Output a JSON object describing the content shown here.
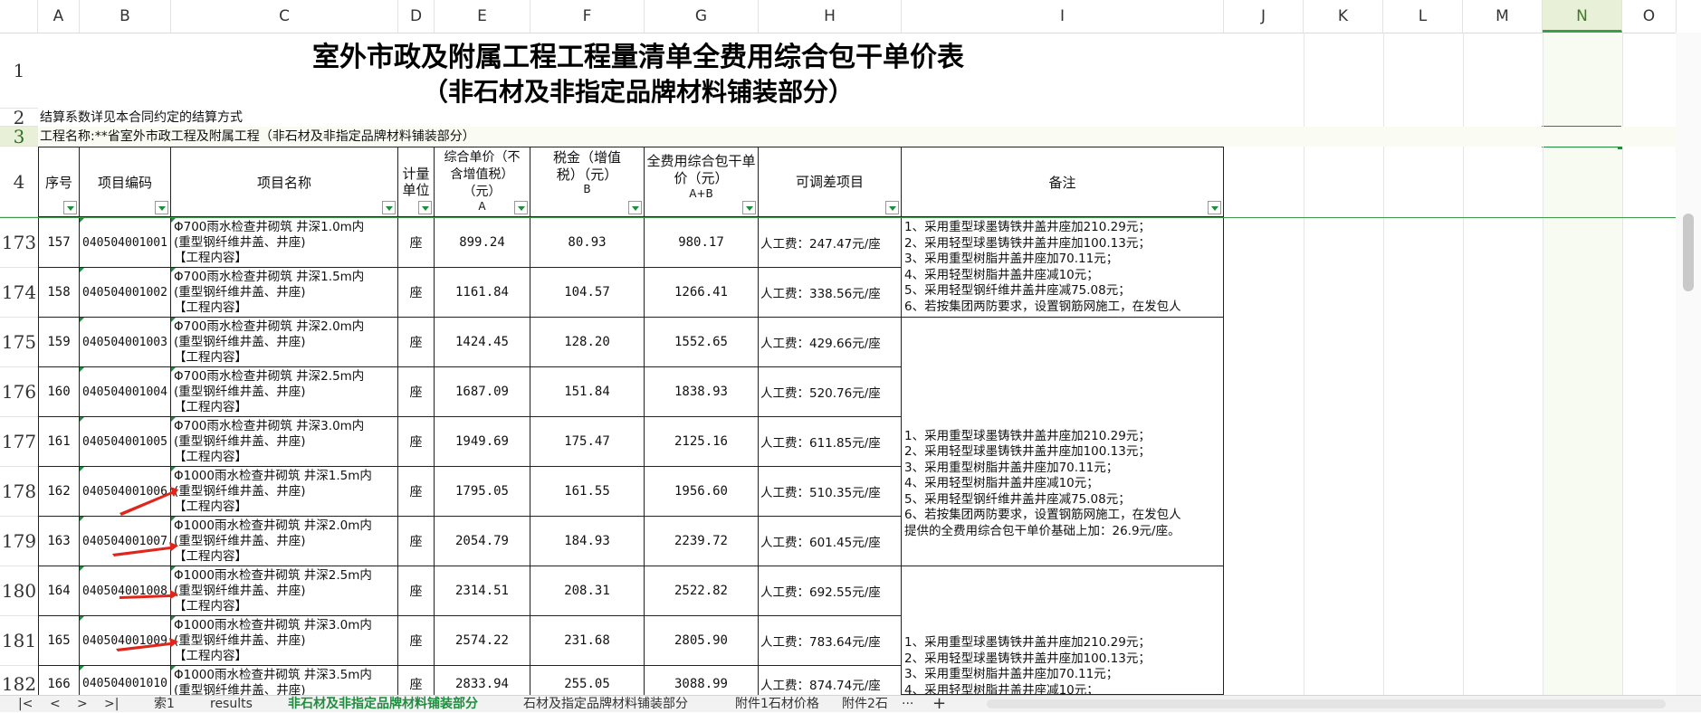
{
  "columns": [
    "A",
    "B",
    "C",
    "D",
    "E",
    "F",
    "G",
    "H",
    "I",
    "J",
    "K",
    "L",
    "M",
    "N",
    "O"
  ],
  "selected_column": "N",
  "rows_top": [
    "1",
    "2",
    "3",
    "4"
  ],
  "title_line1": "室外市政及附属工程工程量清单全费用综合包干单价表",
  "title_line2": "（非石材及非指定品牌材料铺装部分）",
  "row2_text": "结算系数详见本合同约定的结算方式",
  "row3_text": "工程名称:**省室外市政工程及附属工程（非石材及非指定品牌材料铺装部分）",
  "headers": {
    "seq": "序号",
    "code": "项目编码",
    "name": "项目名称",
    "unit": "计量单位",
    "price": "综合单价（不含增值税）（元）",
    "price_sub": "A",
    "tax": "税金（增值税）（元）",
    "tax_sub": "B",
    "total": "全费用综合包干单价（元）",
    "total_sub": "A+B",
    "adjust": "可调差项目",
    "remark": "备注"
  },
  "data_rows": [
    {
      "row": "173",
      "seq": "157",
      "code": "040504001001",
      "name": [
        "Φ700雨水检查井砌筑 井深1.0m内",
        "(重型钢纤维井盖、井座)",
        "【工程内容】"
      ],
      "unit": "座",
      "price": "899.24",
      "tax": "80.93",
      "total": "980.17",
      "adjust": "人工费：247.47元/座"
    },
    {
      "row": "174",
      "seq": "158",
      "code": "040504001002",
      "name": [
        "Φ700雨水检查井砌筑 井深1.5m内",
        "(重型钢纤维井盖、井座)",
        "【工程内容】"
      ],
      "unit": "座",
      "price": "1161.84",
      "tax": "104.57",
      "total": "1266.41",
      "adjust": "人工费：338.56元/座"
    },
    {
      "row": "175",
      "seq": "159",
      "code": "040504001003",
      "name": [
        "Φ700雨水检查井砌筑 井深2.0m内",
        "(重型钢纤维井盖、井座)",
        "【工程内容】"
      ],
      "unit": "座",
      "price": "1424.45",
      "tax": "128.20",
      "total": "1552.65",
      "adjust": "人工费：429.66元/座"
    },
    {
      "row": "176",
      "seq": "160",
      "code": "040504001004",
      "name": [
        "Φ700雨水检查井砌筑 井深2.5m内",
        "(重型钢纤维井盖、井座)",
        "【工程内容】"
      ],
      "unit": "座",
      "price": "1687.09",
      "tax": "151.84",
      "total": "1838.93",
      "adjust": "人工费：520.76元/座"
    },
    {
      "row": "177",
      "seq": "161",
      "code": "040504001005",
      "name": [
        "Φ700雨水检查井砌筑 井深3.0m内",
        "(重型钢纤维井盖、井座)",
        "【工程内容】"
      ],
      "unit": "座",
      "price": "1949.69",
      "tax": "175.47",
      "total": "2125.16",
      "adjust": "人工费：611.85元/座"
    },
    {
      "row": "178",
      "seq": "162",
      "code": "040504001006",
      "name": [
        "Φ1000雨水检查井砌筑 井深1.5m内",
        "(重型钢纤维井盖、井座)",
        "【工程内容】"
      ],
      "unit": "座",
      "price": "1795.05",
      "tax": "161.55",
      "total": "1956.60",
      "adjust": "人工费：510.35元/座"
    },
    {
      "row": "179",
      "seq": "163",
      "code": "040504001007",
      "name": [
        "Φ1000雨水检查井砌筑 井深2.0m内",
        "(重型钢纤维井盖、井座)",
        "【工程内容】"
      ],
      "unit": "座",
      "price": "2054.79",
      "tax": "184.93",
      "total": "2239.72",
      "adjust": "人工费：601.45元/座"
    },
    {
      "row": "180",
      "seq": "164",
      "code": "040504001008",
      "name": [
        "Φ1000雨水检查井砌筑 井深2.5m内",
        "(重型钢纤维井盖、井座)",
        "【工程内容】"
      ],
      "unit": "座",
      "price": "2314.51",
      "tax": "208.31",
      "total": "2522.82",
      "adjust": "人工费：692.55元/座"
    },
    {
      "row": "181",
      "seq": "165",
      "code": "040504001009",
      "name": [
        "Φ1000雨水检查井砌筑 井深3.0m内",
        "(重型钢纤维井盖、井座)",
        "【工程内容】"
      ],
      "unit": "座",
      "price": "2574.22",
      "tax": "231.68",
      "total": "2805.90",
      "adjust": "人工费：783.64元/座"
    },
    {
      "row": "182",
      "seq": "166",
      "code": "040504001010",
      "name": [
        "Φ1000雨水检查井砌筑 井深3.5m内",
        "(重型钢纤维井盖、井座)"
      ],
      "unit": "座",
      "price": "2833.94",
      "tax": "255.05",
      "total": "3088.99",
      "adjust": "人工费：874.74元/座"
    }
  ],
  "remarks": {
    "block1": "1、采用重型球墨铸铁井盖井座加210.29元；\n2、采用轻型球墨铸铁井盖井座加100.13元；\n3、采用重型树脂井盖井座加70.11元；\n4、采用轻型树脂井盖井座减10元；\n5、采用轻型钢纤维井盖井座减75.08元；\n6、若按集团两防要求，设置钢筋网施工，在发包人",
    "block2": "1、采用重型球墨铸铁井盖井座加210.29元；\n2、采用轻型球墨铸铁井盖井座加100.13元；\n3、采用重型树脂井盖井座加70.11元；\n4、采用轻型树脂井盖井座减10元；\n5、采用轻型钢纤维井盖井座减75.08元；\n6、若按集团两防要求，设置钢筋网施工，在发包人\n提供的全费用综合包干单价基础上加：26.9元/座。",
    "block3": "1、采用重型球墨铸铁井盖井座加210.29元；\n2、采用轻型球墨铸铁井盖井座加100.13元；\n3、采用重型树脂井盖井座加70.11元；\n4、采用轻型树脂井盖井座减10元；"
  },
  "sheet_tabs": [
    "索1",
    "results",
    "非石材及非指定品牌材料铺装部分",
    "石材及指定品牌材料铺装部分",
    "附件1石材价格",
    "附件2石"
  ],
  "active_tab_index": 2,
  "tab_extra": [
    "···",
    "+"
  ],
  "nav_buttons": [
    "|<",
    "<",
    ">",
    ">|"
  ],
  "colors": {
    "accent": "#1e8d3e",
    "selected_col_bg": "#e9f0d8",
    "arrow": "#e0251b"
  }
}
